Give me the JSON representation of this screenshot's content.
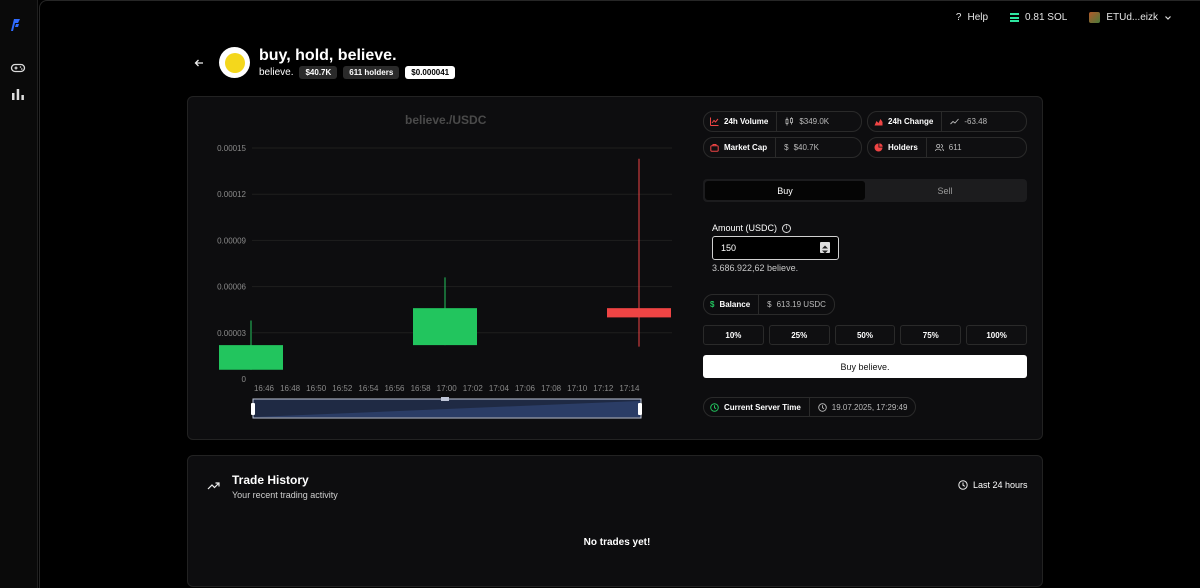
{
  "topbar": {
    "help": "Help",
    "sol_balance": "0.81 SOL",
    "wallet": "ETUd...eizk"
  },
  "token": {
    "name": "buy, hold, believe.",
    "symbol": "believe.",
    "market_cap_chip": "$40.7K",
    "holders_chip": "611 holders",
    "price_chip": "$0.000041"
  },
  "chart": {
    "pair": "believe./USDC"
  },
  "chart_data": {
    "type": "candlestick",
    "title": "believe./USDC",
    "y_ticks": [
      "0",
      "0.00003",
      "0.00006",
      "0.00009",
      "0.00012",
      "0.00015"
    ],
    "ylim": [
      0,
      0.00015
    ],
    "x_ticks": [
      "16:46",
      "16:48",
      "16:50",
      "16:52",
      "16:54",
      "16:56",
      "16:58",
      "17:00",
      "17:02",
      "17:04",
      "17:06",
      "17:08",
      "17:10",
      "17:12",
      "17:14"
    ],
    "candles": [
      {
        "time": "16:46",
        "open": 6e-06,
        "close": 2.2e-05,
        "high": 3.8e-05,
        "low": 6e-06,
        "color": "#22c55e"
      },
      {
        "time": "16:58",
        "open": 2.2e-05,
        "close": 4.6e-05,
        "high": 6.6e-05,
        "low": 2.2e-05,
        "color": "#22c55e"
      },
      {
        "time": "17:14",
        "open": 4.6e-05,
        "close": 4e-05,
        "high": 0.000143,
        "low": 2.1e-05,
        "color": "#ef4444"
      }
    ]
  },
  "stats": {
    "volume_label": "24h Volume",
    "volume_value": "$349.0K",
    "change_label": "24h Change",
    "change_value": "-63.48",
    "mcap_label": "Market Cap",
    "mcap_value": "$40.7K",
    "holders_label": "Holders",
    "holders_value": "611"
  },
  "trade": {
    "tab_buy": "Buy",
    "tab_sell": "Sell",
    "amount_label": "Amount (USDC)",
    "amount_value": "150",
    "conversion": "3.686.922,62 believe.",
    "balance_label": "Balance",
    "balance_value": "613.19 USDC",
    "pcts": [
      "10%",
      "25%",
      "50%",
      "75%",
      "100%"
    ],
    "buy_button": "Buy believe.",
    "server_time_label": "Current Server Time",
    "server_time_value": "19.07.2025, 17:29:49"
  },
  "history": {
    "title": "Trade History",
    "subtitle": "Your recent trading activity",
    "range": "Last 24 hours",
    "empty": "No trades yet!"
  }
}
